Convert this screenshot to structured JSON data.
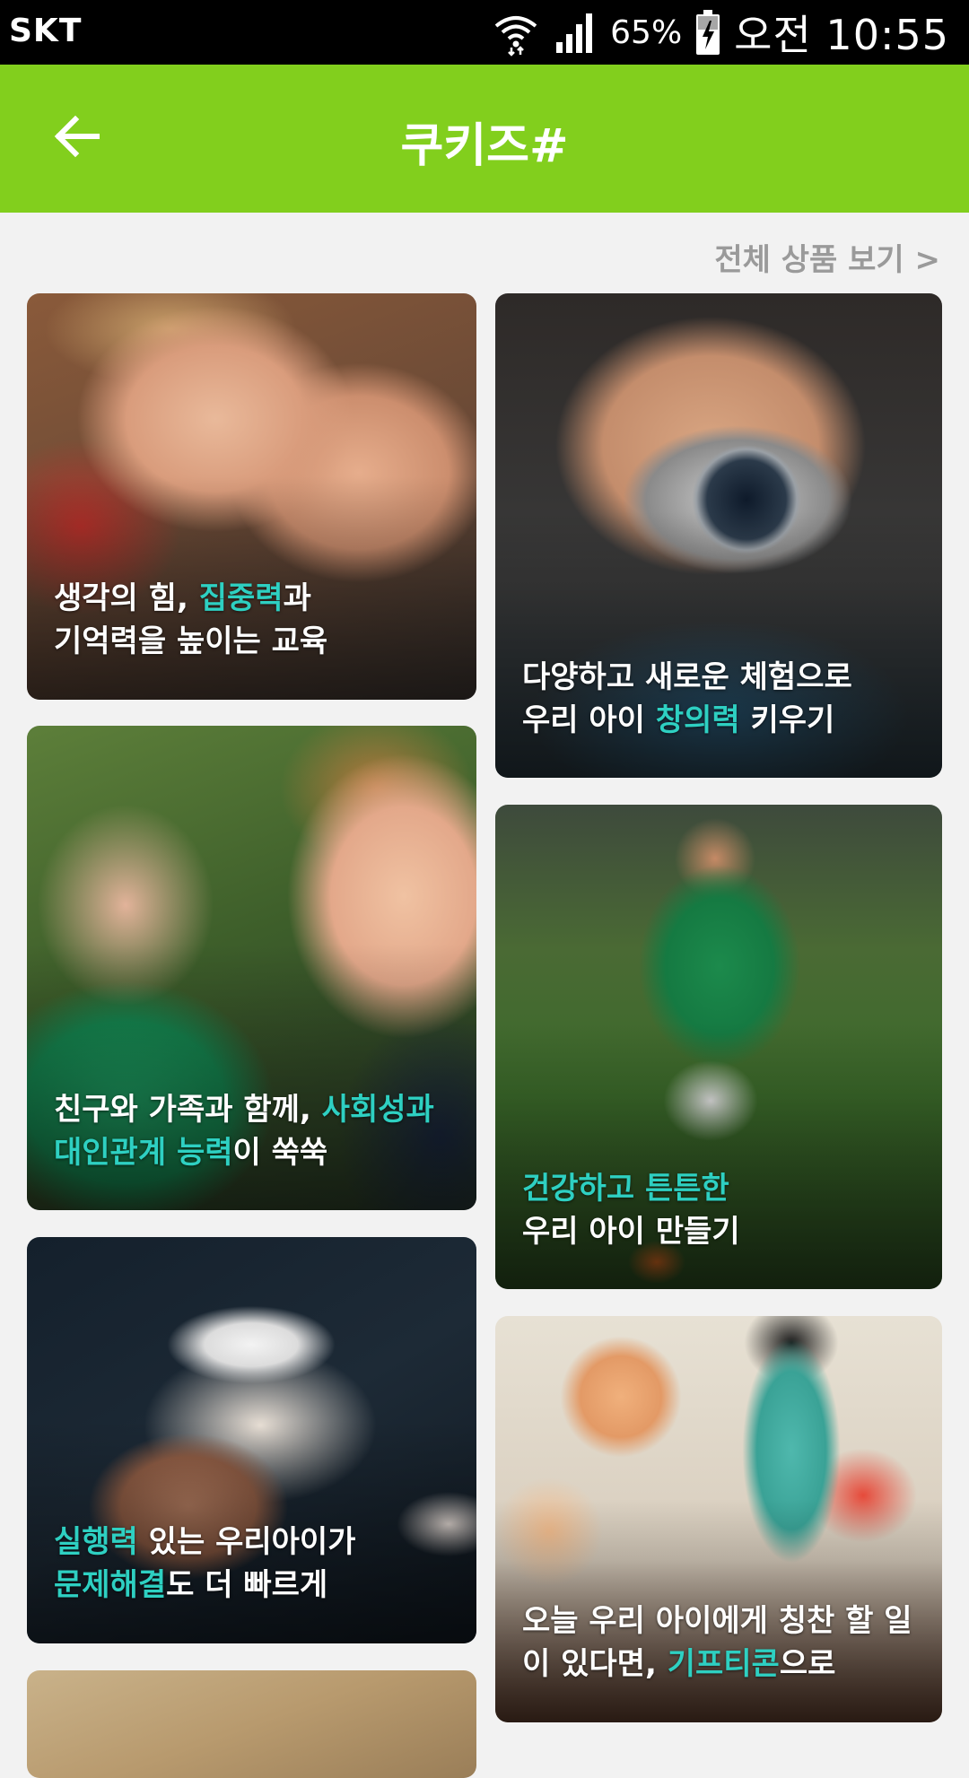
{
  "status_bar": {
    "carrier": "SKT",
    "battery_pct": "65%",
    "clock": "오전 10:55"
  },
  "app_bar": {
    "title": "쿠키즈#",
    "color": "#82cf1d"
  },
  "view_all_label": "전체 상품 보기 >",
  "highlight_color": "#2ed0c2",
  "cards": [
    {
      "line1": [
        "생각의 힘, ",
        "집중력",
        "과"
      ],
      "line2": [
        "기억력을 높이는 교육",
        "",
        ""
      ]
    },
    {
      "line1": [
        "다양하고 새로운 체험으로",
        "",
        ""
      ],
      "line2": [
        "우리 아이 ",
        "창의력",
        " 키우기"
      ]
    },
    {
      "line1": [
        "친구와 가족과 함께, ",
        "사회성과",
        ""
      ],
      "line2": [
        "",
        "대인관계 능력",
        "이 쑥쑥"
      ]
    },
    {
      "line1": [
        "",
        "건강하고 튼튼한",
        ""
      ],
      "line2": [
        "우리 아이 만들기",
        "",
        ""
      ]
    },
    {
      "line1": [
        "",
        "실행력",
        " 있는 우리아이가"
      ],
      "line2": [
        "",
        "문제해결",
        "도 더 빠르게"
      ]
    },
    {
      "line1": [
        "오늘 우리 아이에게 칭찬 할 일",
        "",
        ""
      ],
      "line2": [
        "이 있다면, ",
        "기프티콘",
        "으로"
      ]
    }
  ]
}
